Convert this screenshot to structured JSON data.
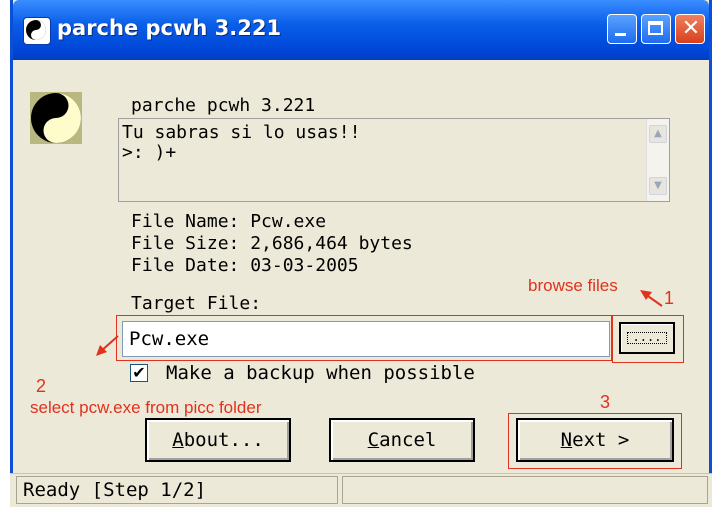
{
  "window": {
    "title": "parche pcwh 3.221"
  },
  "info": {
    "app_name": "parche pcwh 3.221",
    "notes_line1": "Tu sabras si lo usas!!",
    "notes_line2": ">: )+",
    "file_name": "File Name: Pcw.exe",
    "file_size": "File Size: 2,686,464 bytes",
    "file_date": "File Date: 03-03-2005"
  },
  "target": {
    "label": "Target File:",
    "value": "Pcw.exe",
    "browse_label": "....",
    "backup_checked": true,
    "backup_label": "Make a backup when possible"
  },
  "buttons": {
    "about_first": "A",
    "about_rest": "bout...",
    "cancel_first": "C",
    "cancel_rest": "ancel",
    "next_first": "N",
    "next_rest": "ext >"
  },
  "status": {
    "text": "Ready [Step 1/2]"
  },
  "annotations": {
    "browse_files": "browse files",
    "step1": "1",
    "step2": "2",
    "select_hint": "select pcw.exe from picc folder",
    "step3": "3"
  },
  "colors": {
    "annotation": "#e0321e",
    "titlebar": "#0a5ee8",
    "window_bg": "#ece9d8"
  },
  "icons": {
    "app": "yin-yang-10-icon",
    "title": "yin-yang-title-icon"
  }
}
